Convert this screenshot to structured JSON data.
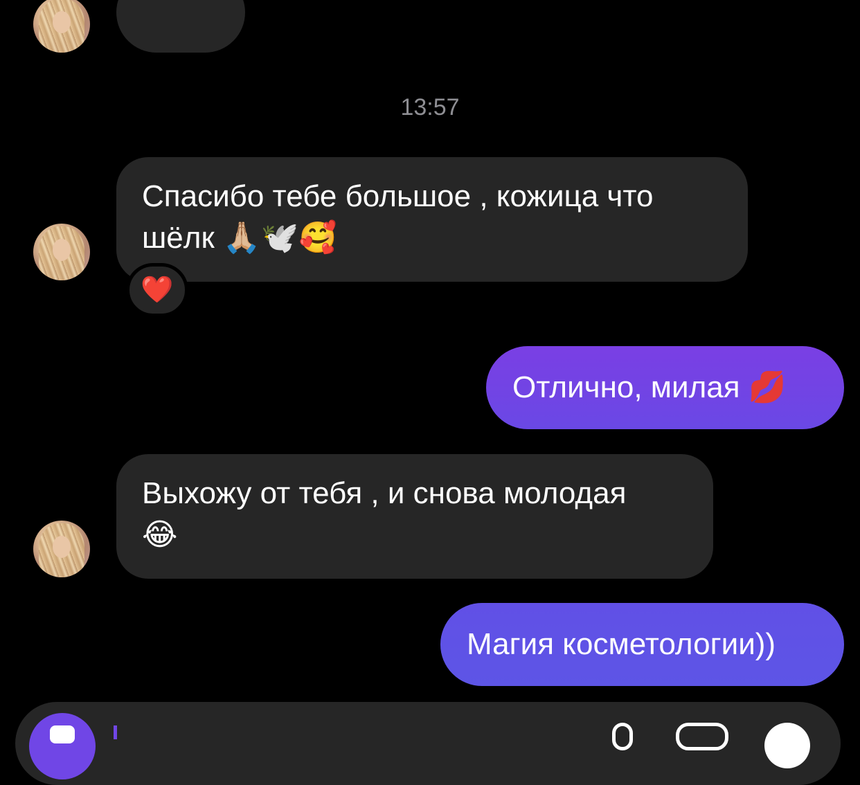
{
  "conversation": {
    "timestamp": "13:57",
    "messages": [
      {
        "direction": "incoming",
        "lines": [
          "Спасибо тебе большое , кожица что",
          "шёлк 🙏🏼🕊️🥰"
        ],
        "reaction": "❤️"
      },
      {
        "direction": "outgoing",
        "text": "Отлично, милая 💋"
      },
      {
        "direction": "incoming",
        "lines": [
          "Выхожу от тебя , и снова молодая",
          "😂"
        ]
      },
      {
        "direction": "outgoing",
        "text": "Магия косметологии))"
      }
    ]
  },
  "colors": {
    "background": "#000000",
    "incoming_bubble": "#262626",
    "outgoing_gradient_top": "#7a3fe4",
    "outgoing_gradient_bottom": "#5d55e6",
    "timestamp_text": "#8e8e93",
    "accent": "#7046e6"
  },
  "icons": {
    "camera": "camera-icon",
    "microphone": "microphone-icon",
    "gallery": "gallery-icon",
    "sticker": "sticker-icon"
  }
}
